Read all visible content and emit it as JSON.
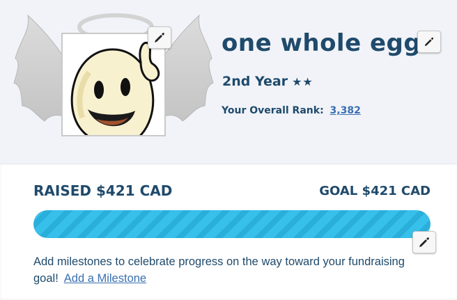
{
  "profile": {
    "name": "one whole egg",
    "year": "2nd Year",
    "stars": "★★",
    "rank_label": "Your Overall Rank:",
    "rank_value": "3,382"
  },
  "fundraising": {
    "raised": "RAISED $421 CAD",
    "goal": "GOAL $421 CAD",
    "progress_fraction": 1.0,
    "milestone_text": "Add milestones to celebrate progress on the way toward your fundraising goal!",
    "milestone_link": "Add a Milestone"
  },
  "icons": {
    "edit": "pencil-icon",
    "wings": "angel-wings-icon",
    "halo": "halo-icon"
  },
  "colors": {
    "text": "#1f4a6b",
    "link": "#3a6fb0",
    "progress": "#36c0ea",
    "panel": "#f1f3f8"
  }
}
